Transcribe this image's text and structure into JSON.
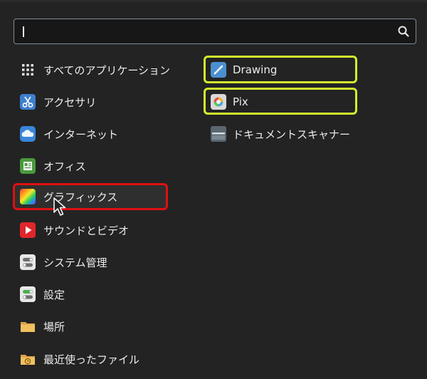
{
  "search": {
    "value": "",
    "placeholder": "",
    "icon": "search-icon"
  },
  "categories": [
    {
      "label": "すべてのアプリケーション",
      "icon": "grid-icon"
    },
    {
      "label": "アクセサリ",
      "icon": "scissors-icon"
    },
    {
      "label": "インターネット",
      "icon": "cloud-icon"
    },
    {
      "label": "オフィス",
      "icon": "document-icon"
    },
    {
      "label": "グラフィックス",
      "icon": "graphics-icon",
      "selected": true
    },
    {
      "label": "サウンドとビデオ",
      "icon": "play-icon"
    },
    {
      "label": "システム管理",
      "icon": "toggles-icon"
    },
    {
      "label": "設定",
      "icon": "settings-icon"
    },
    {
      "label": "場所",
      "icon": "folder-icon"
    },
    {
      "label": "最近使ったファイル",
      "icon": "recent-folder-icon"
    }
  ],
  "apps": [
    {
      "label": "Drawing",
      "icon": "pencil-icon",
      "highlight": "yellow"
    },
    {
      "label": "Pix",
      "icon": "pix-icon",
      "highlight": "yellow"
    },
    {
      "label": "ドキュメントスキャナー",
      "icon": "scanner-icon"
    }
  ],
  "colors": {
    "background": "#232323",
    "search_border": "#7f8a97",
    "highlight_red": "#e01010",
    "highlight_yellow": "#d3ef2e"
  }
}
